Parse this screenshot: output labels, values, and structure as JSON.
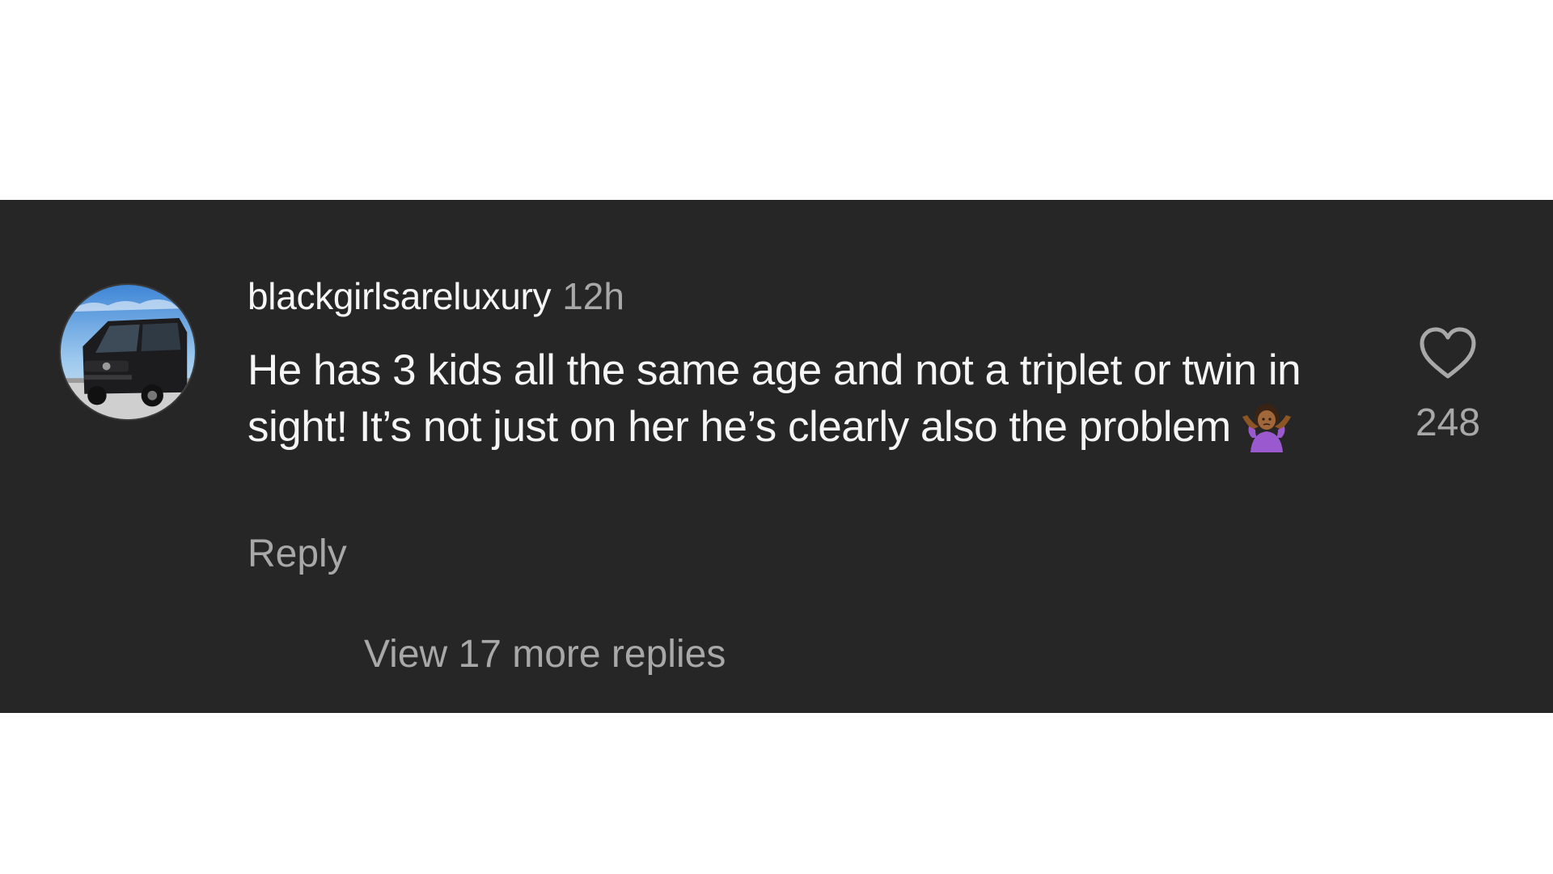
{
  "comment": {
    "username": "blackgirlsareluxury",
    "timestamp": "12h",
    "text": "He has 3 kids all the same age and not a triplet or twin in sight! It’s not just on her he’s clearly also the problem",
    "emoji": "person-shrugging",
    "reply_label": "Reply",
    "like_count": "248",
    "view_replies_label": "View 17 more replies"
  },
  "colors": {
    "background": "#262626",
    "primary_text": "#f5f5f5",
    "secondary_text": "#a8a8a8"
  },
  "icons": {
    "avatar": "avatar-van-photo",
    "like": "heart-outline-icon",
    "emoji": "person-shrugging-emoji"
  }
}
